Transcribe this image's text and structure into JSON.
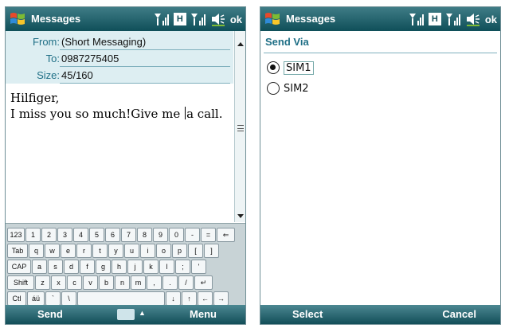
{
  "left_screen": {
    "title": "Messages",
    "tray": {
      "network_type": "H",
      "ok_label": "ok"
    },
    "fields": [
      {
        "label": "From:",
        "value": "(Short Messaging)"
      },
      {
        "label": "To:",
        "value": "0987275405"
      },
      {
        "label": "Size:",
        "value": "45/160"
      }
    ],
    "message": {
      "line1": "Hilfiger,",
      "line2_before_caret": "I miss you so much!Give me ",
      "line2_after_caret": "a call."
    },
    "keyboard": {
      "rows": [
        [
          "123",
          "1",
          "2",
          "3",
          "4",
          "5",
          "6",
          "7",
          "8",
          "9",
          "0",
          "-",
          "=",
          "⇐"
        ],
        [
          "Tab",
          "q",
          "w",
          "e",
          "r",
          "t",
          "y",
          "u",
          "i",
          "o",
          "p",
          "[",
          "]"
        ],
        [
          "CAP",
          "a",
          "s",
          "d",
          "f",
          "g",
          "h",
          "j",
          "k",
          "l",
          ";",
          "'"
        ],
        [
          "Shift",
          "z",
          "x",
          "c",
          "v",
          "b",
          "n",
          "m",
          ",",
          ".",
          "/",
          "↵"
        ],
        [
          "Ctl",
          "áü",
          "`",
          "\\",
          "",
          "↓",
          "↑",
          "←",
          "→"
        ]
      ]
    },
    "softkeys": {
      "left": "Send",
      "right": "Menu"
    }
  },
  "right_screen": {
    "title": "Messages",
    "tray": {
      "network_type": "H",
      "ok_label": "ok"
    },
    "section_title": "Send Via",
    "options": [
      {
        "label": "SIM1",
        "selected": true
      },
      {
        "label": "SIM2",
        "selected": false
      }
    ],
    "softkeys": {
      "left": "Select",
      "right": "Cancel"
    }
  }
}
